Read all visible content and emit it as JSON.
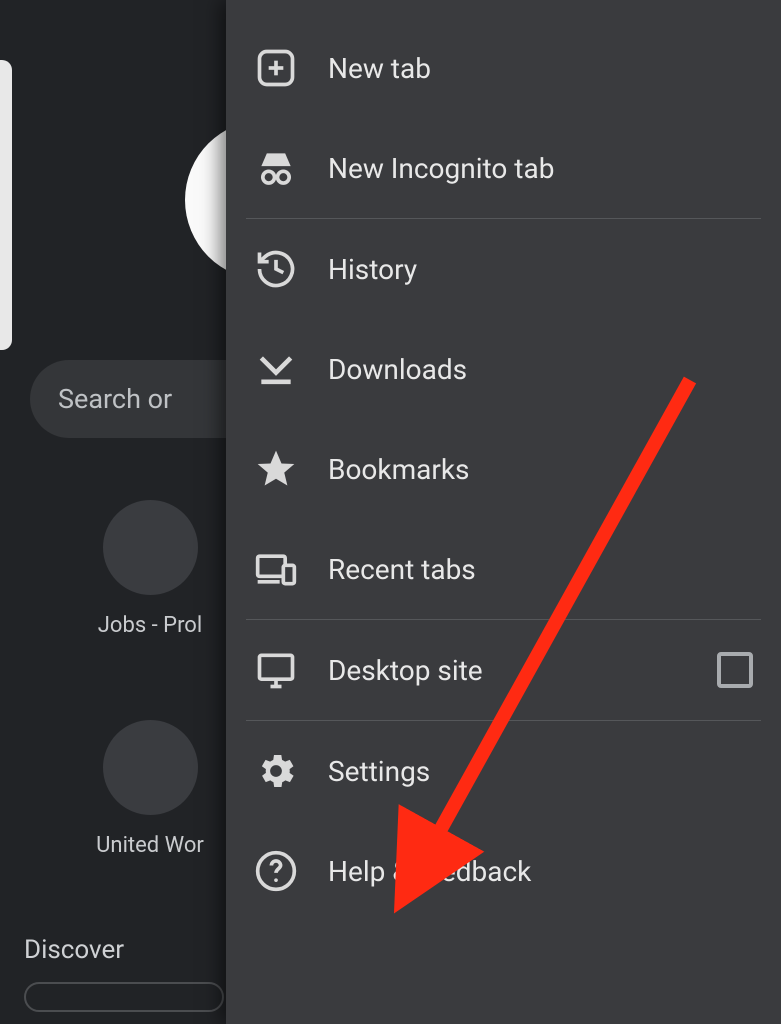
{
  "background": {
    "search_placeholder": "Search or ",
    "shortcut1_label": "Jobs - Prol",
    "shortcut2_label": "United Wor",
    "discover_label": "Discover"
  },
  "menu": {
    "new_tab": "New tab",
    "new_incognito_tab": "New Incognito tab",
    "history": "History",
    "downloads": "Downloads",
    "bookmarks": "Bookmarks",
    "recent_tabs": "Recent tabs",
    "desktop_site": "Desktop site",
    "settings": "Settings",
    "help_feedback": "Help & feedback"
  },
  "annotation": {
    "arrow_color": "#ff2a12"
  }
}
